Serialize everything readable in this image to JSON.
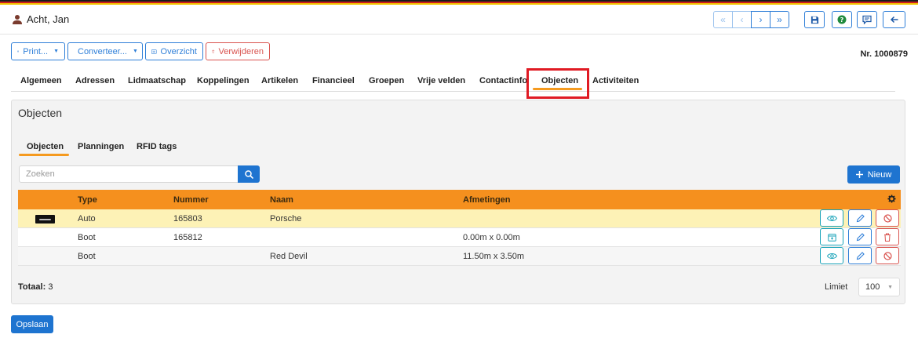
{
  "colors": {
    "accent": "#1e74d0",
    "orange": "#f5901e",
    "danger": "#d9534f",
    "teal": "#17a2b8",
    "selected_row": "#fdf2b6",
    "highlight": "#e01b24"
  },
  "header": {
    "title": "Acht, Jan",
    "icon": "user-icon"
  },
  "nav": {
    "first": "«",
    "prev": "‹",
    "next": "›",
    "last": "»"
  },
  "toolbar": {
    "print": "Print...",
    "convert": "Converteer...",
    "overview": "Overzicht",
    "delete": "Verwijderen"
  },
  "record": {
    "number": "Nr. 1000879"
  },
  "tabs": [
    {
      "label": "Algemeen"
    },
    {
      "label": "Adressen"
    },
    {
      "label": "Lidmaatschap"
    },
    {
      "label": "Koppelingen"
    },
    {
      "label": "Artikelen"
    },
    {
      "label": "Financieel"
    },
    {
      "label": "Groepen"
    },
    {
      "label": "Vrije velden"
    },
    {
      "label": "Contactinfo"
    },
    {
      "label": "Objecten",
      "active": true
    },
    {
      "label": "Activiteiten"
    }
  ],
  "panel": {
    "title": "Objecten",
    "subtabs": [
      {
        "label": "Objecten",
        "active": true
      },
      {
        "label": "Planningen"
      },
      {
        "label": "RFID tags"
      }
    ],
    "search": {
      "placeholder": "Zoeken",
      "value": ""
    },
    "new_label": "Nieuw"
  },
  "table": {
    "columns": [
      "Type",
      "Nummer",
      "Naam",
      "Afmetingen"
    ],
    "rows": [
      {
        "type": "Auto",
        "nummer": "165803",
        "naam": "Porsche",
        "afmetingen": "",
        "has_image": true,
        "selected": true,
        "actions": [
          "eye-icon",
          "pencil-icon",
          "ban-icon"
        ]
      },
      {
        "type": "Boot",
        "nummer": "165812",
        "naam": "",
        "afmetingen": "0.00m x 0.00m",
        "has_image": false,
        "actions": [
          "calendar-icon",
          "pencil-icon",
          "trash-icon"
        ]
      },
      {
        "type": "Boot",
        "nummer": "",
        "naam": "Red Devil",
        "afmetingen": "11.50m x 3.50m",
        "has_image": false,
        "actions": [
          "eye-icon",
          "pencil-icon",
          "ban-icon"
        ]
      }
    ]
  },
  "footer": {
    "total_label": "Totaal:",
    "total_value": "3",
    "limit_label": "Limiet",
    "limit_value": "100"
  },
  "save_label": "Opslaan"
}
